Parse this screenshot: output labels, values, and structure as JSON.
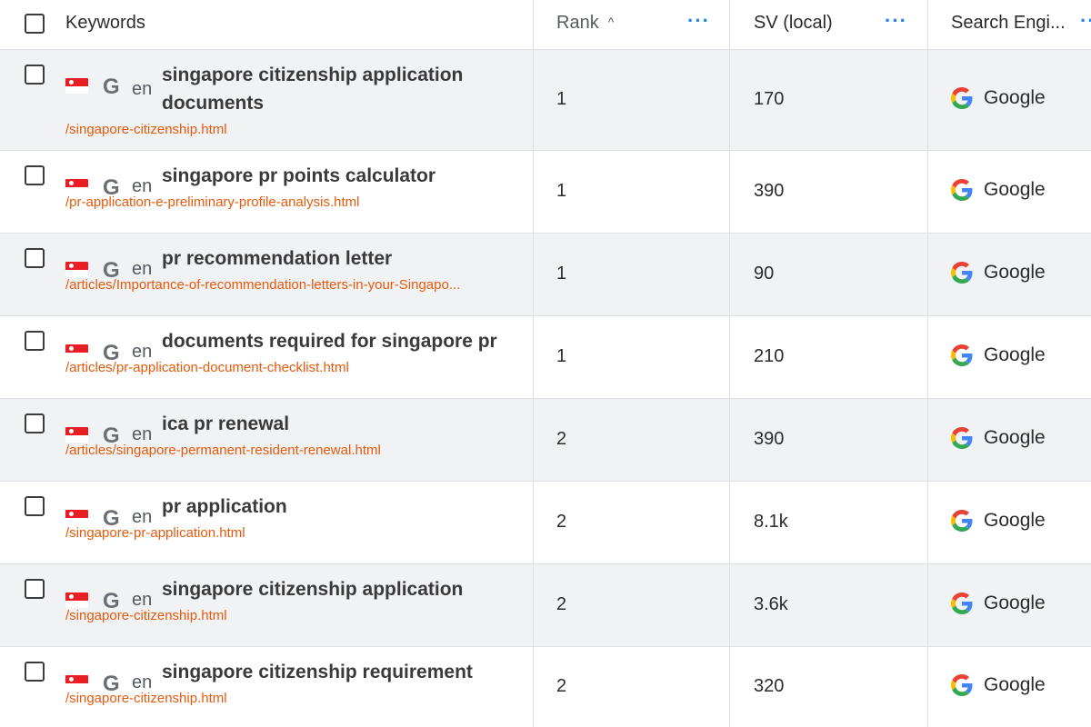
{
  "header": {
    "keywords_label": "Keywords",
    "rank_label": "Rank",
    "rank_sort": "^",
    "sv_label": "SV (local)",
    "engine_label": "Search Engi...",
    "more_dots": "···"
  },
  "colors": {
    "url": "#e8590c",
    "menu_dots": "#1e88e5",
    "row_alt": "#f1f2f4",
    "flag_red": "#ea1c24"
  },
  "rows": [
    {
      "country_flag": "singapore-flag-icon",
      "engine_glyph": "G",
      "lang": "en",
      "keyword_line1": "singapore citizenship application",
      "keyword_line2": "documents",
      "url": "/singapore-citizenship.html",
      "rank": "1",
      "sv": "170",
      "engine": "Google"
    },
    {
      "country_flag": "singapore-flag-icon",
      "engine_glyph": "G",
      "lang": "en",
      "keyword_line1": "singapore pr points calculator",
      "keyword_line2": "",
      "url": "/pr-application-e-preliminary-profile-analysis.html",
      "rank": "1",
      "sv": "390",
      "engine": "Google"
    },
    {
      "country_flag": "singapore-flag-icon",
      "engine_glyph": "G",
      "lang": "en",
      "keyword_line1": "pr recommendation letter",
      "keyword_line2": "",
      "url": "/articles/Importance-of-recommendation-letters-in-your-Singapo...",
      "rank": "1",
      "sv": "90",
      "engine": "Google"
    },
    {
      "country_flag": "singapore-flag-icon",
      "engine_glyph": "G",
      "lang": "en",
      "keyword_line1": "documents required for singapore pr",
      "keyword_line2": "",
      "url": "/articles/pr-application-document-checklist.html",
      "rank": "1",
      "sv": "210",
      "engine": "Google"
    },
    {
      "country_flag": "singapore-flag-icon",
      "engine_glyph": "G",
      "lang": "en",
      "keyword_line1": "ica pr renewal",
      "keyword_line2": "",
      "url": "/articles/singapore-permanent-resident-renewal.html",
      "rank": "2",
      "sv": "390",
      "engine": "Google"
    },
    {
      "country_flag": "singapore-flag-icon",
      "engine_glyph": "G",
      "lang": "en",
      "keyword_line1": "pr application",
      "keyword_line2": "",
      "url": "/singapore-pr-application.html",
      "rank": "2",
      "sv": "8.1k",
      "engine": "Google"
    },
    {
      "country_flag": "singapore-flag-icon",
      "engine_glyph": "G",
      "lang": "en",
      "keyword_line1": "singapore citizenship application",
      "keyword_line2": "",
      "url": "/singapore-citizenship.html",
      "rank": "2",
      "sv": "3.6k",
      "engine": "Google"
    },
    {
      "country_flag": "singapore-flag-icon",
      "engine_glyph": "G",
      "lang": "en",
      "keyword_line1": "singapore citizenship requirement",
      "keyword_line2": "",
      "url": "/singapore-citizenship.html",
      "rank": "2",
      "sv": "320",
      "engine": "Google"
    }
  ]
}
